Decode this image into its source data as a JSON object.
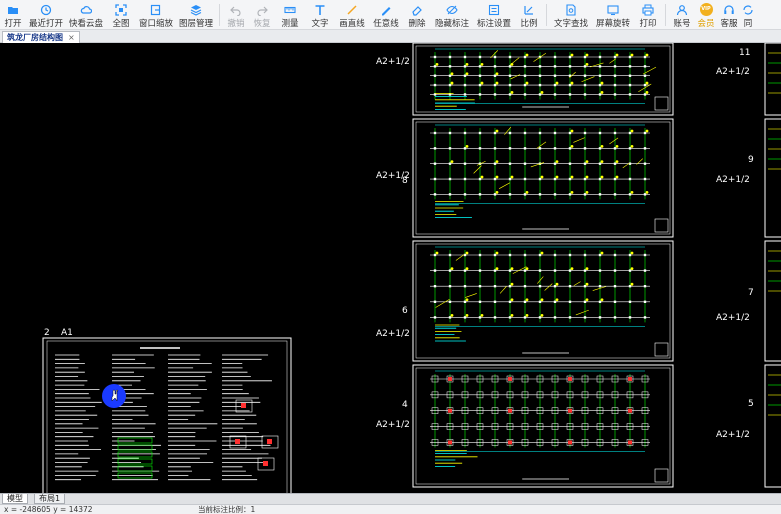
{
  "toolbar": {
    "items": [
      {
        "label": "打开",
        "icon": "folder-open-icon"
      },
      {
        "label": "最近打开",
        "icon": "history-icon"
      },
      {
        "label": "快看云盘",
        "icon": "cloud-icon"
      },
      {
        "label": "全图",
        "icon": "fit-all-icon"
      },
      {
        "label": "窗口缩放",
        "icon": "window-zoom-icon"
      },
      {
        "label": "图层管理",
        "icon": "layers-icon"
      },
      {
        "label": "撤销",
        "icon": "undo-icon",
        "disabled": true
      },
      {
        "label": "恢复",
        "icon": "redo-icon",
        "disabled": true
      },
      {
        "label": "测量",
        "icon": "measure-icon"
      },
      {
        "label": "文字",
        "icon": "text-icon"
      },
      {
        "label": "画直线",
        "icon": "line-icon"
      },
      {
        "label": "任意线",
        "icon": "freehand-icon"
      },
      {
        "label": "删除",
        "icon": "eraser-icon"
      },
      {
        "label": "隐藏标注",
        "icon": "eye-hide-icon"
      },
      {
        "label": "标注设置",
        "icon": "annotation-settings-icon"
      },
      {
        "label": "比例",
        "icon": "scale-icon"
      },
      {
        "label": "文字查找",
        "icon": "text-search-icon"
      },
      {
        "label": "屏幕旋转",
        "icon": "rotate-screen-icon"
      },
      {
        "label": "打印",
        "icon": "print-icon"
      },
      {
        "label": "账号",
        "icon": "user-icon"
      },
      {
        "label": "会员",
        "icon": "vip-icon",
        "badge": "VIP"
      },
      {
        "label": "客服",
        "icon": "headset-icon"
      },
      {
        "label": "同",
        "icon": "sync-icon"
      }
    ]
  },
  "document_tab": {
    "title": "筑龙厂房结构图",
    "close": "×"
  },
  "drawing": {
    "sheet_main_number": "2",
    "sheet_main_size": "A1",
    "col1_labels": [
      {
        "number": "8",
        "size": "A2+1/2"
      },
      {
        "number": "6",
        "size": "A2+1/2"
      },
      {
        "number": "4",
        "size": "A2+1/2"
      }
    ],
    "col1_top_size": "A2+1/2",
    "col2_labels": [
      {
        "number": "11",
        "size": "A2+1/2"
      },
      {
        "number": "9",
        "size": "A2+1/2"
      },
      {
        "number": "7",
        "size": "A2+1/2"
      },
      {
        "number": "5",
        "size": "A2+1/2"
      }
    ],
    "colors": {
      "frame": "#ffffff",
      "grid": "#00ff00",
      "annotation": "#ffff00",
      "dimension": "#00ffff",
      "column": "#ff3030",
      "cursor": "#1a3aff"
    }
  },
  "layout_tabs": [
    {
      "label": "模型"
    },
    {
      "label": "布局1"
    }
  ],
  "status": {
    "coords": "x = -248605  y = 14372",
    "scale": "当前标注比例：1"
  }
}
